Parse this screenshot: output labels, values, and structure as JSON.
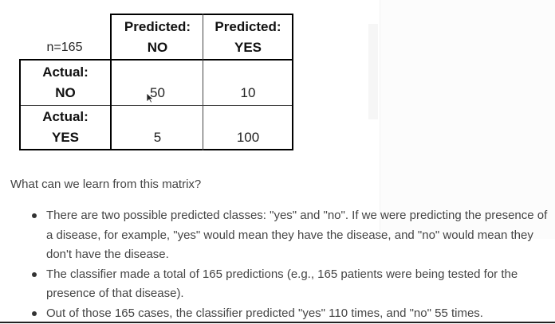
{
  "matrix": {
    "n_label": "n=165",
    "col_headers": [
      {
        "line1": "Predicted:",
        "line2": "NO"
      },
      {
        "line1": "Predicted:",
        "line2": "YES"
      }
    ],
    "row_headers": [
      {
        "line1": "Actual:",
        "line2": "NO"
      },
      {
        "line1": "Actual:",
        "line2": "YES"
      }
    ],
    "values": [
      [
        "50",
        "10"
      ],
      [
        "5",
        "100"
      ]
    ]
  },
  "caption": "What can we learn from this matrix?",
  "bullets": [
    "There are two possible predicted classes: \"yes\" and \"no\". If we were predicting the presence of a disease, for example, \"yes\" would mean they have the disease, and \"no\" would mean they don't have the disease.",
    "The classifier made a total of 165 predictions (e.g., 165 patients were being tested for the presence of that disease).",
    "Out of those 165 cases, the classifier predicted \"yes\" 110 times, and \"no\" 55 times."
  ]
}
